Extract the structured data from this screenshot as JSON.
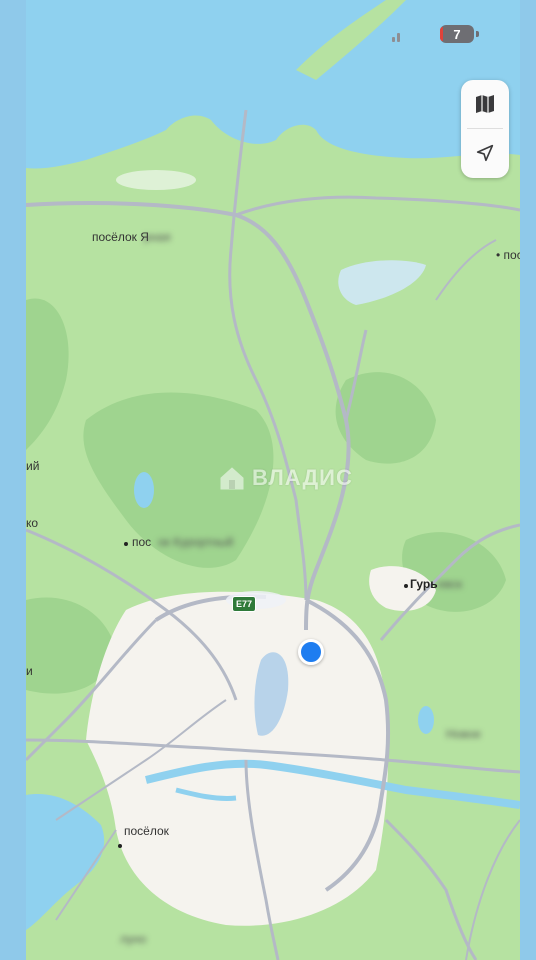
{
  "status_bar": {
    "battery_level": "7",
    "battery_color": "#6e6e73",
    "signal_icon": "signal-icon"
  },
  "map_controls": {
    "map_type_icon": "map-icon",
    "locate_icon": "navigation-arrow-icon"
  },
  "watermark": {
    "text": "ВЛАДИС",
    "icon": "house-logo-icon"
  },
  "road_shield": {
    "label": "E77",
    "color": "#2f7a3a"
  },
  "place_labels": {
    "posyolok_yantarny": "посёлок Я",
    "posyolok_yantarny_blur": "рная",
    "posyolok_right": "• пос",
    "iy_left": "ий",
    "ko_left": "ко",
    "posyolok_kurort": "пос",
    "posyolok_kurort_blur": "ок Курортный",
    "guryevsk": "Гурь",
    "guryevsk_blur": "евск",
    "i_left": "и",
    "novoe_blur": "Новое",
    "posyolok_bottom": "посёлок",
    "bottom_blur": "луно"
  },
  "colors": {
    "water": "#8fd1ef",
    "land": "#b6e2a1",
    "forest": "#9fd48f",
    "urban": "#f5f3ee",
    "road": "#b4b9c6",
    "pin": "#1e7df0"
  }
}
